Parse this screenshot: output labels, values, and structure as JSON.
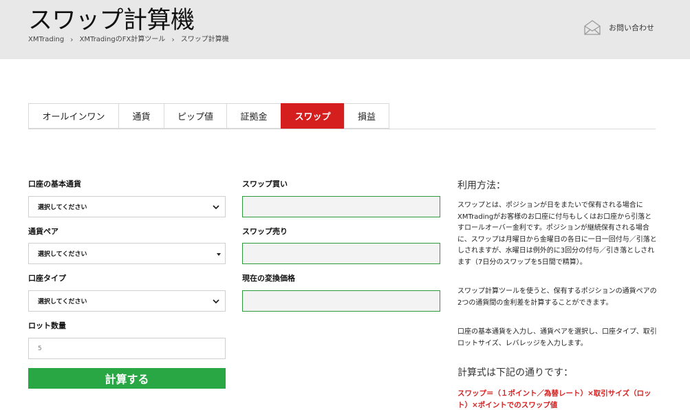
{
  "header": {
    "title": "スワップ計算機",
    "breadcrumb": [
      "XMTrading",
      "XMTradingのFX計算ツール",
      "スワップ計算機"
    ],
    "breadcrumb_separator": "›",
    "contact_label": "お問い合わせ",
    "contact_icon": "mail-icon"
  },
  "tabs": [
    {
      "label": "オールインワン",
      "active": false
    },
    {
      "label": "通貨",
      "active": false
    },
    {
      "label": "ピップ値",
      "active": false
    },
    {
      "label": "証拠金",
      "active": false
    },
    {
      "label": "スワップ",
      "active": true
    },
    {
      "label": "損益",
      "active": false
    }
  ],
  "form": {
    "base_currency": {
      "label": "口座の基本通貨",
      "value": "選択してください"
    },
    "currency_pair": {
      "label": "通貨ペア",
      "value": "選択してください"
    },
    "account_type": {
      "label": "口座タイプ",
      "value": "選択してください"
    },
    "lot_size": {
      "label": "ロット数量",
      "value": "5"
    },
    "calculate_label": "計算する"
  },
  "results": {
    "swap_buy": {
      "label": "スワップ買い",
      "value": ""
    },
    "swap_sell": {
      "label": "スワップ売り",
      "value": ""
    },
    "conversion_price": {
      "label": "現在の変換価格",
      "value": ""
    }
  },
  "usage": {
    "title": "利用方法：",
    "paragraphs": [
      "スワップとは、ポジションが日をまたいで保有される場合にXMTradingがお客様のお口座に付与もしくはお口座から引落とすロールオーバー金利です。ポジションが継続保有される場合に、スワップは月曜日から金曜日の各日に一日一回付与／引落としされますが、水曜日は例外的に3回分の付与／引き落としされます（7日分のスワップを5日間で精算）。",
      "スワップ計算ツールを使うと、保有するポジションの通貨ペアの2つの通貨間の金利差を計算することができます。",
      "口座の基本通貨を入力し、通貨ペアを選択し、口座タイプ、取引ロットサイズ、レバレッジを入力します。"
    ],
    "formula_title": "計算式は下記の通りです：",
    "formula": "スワップ＝（１ポイント／為替レート）×取引サイズ（ロット）×ポイントでのスワップ値"
  },
  "colors": {
    "accent_red": "#d51f1f",
    "button_green": "#2aa745",
    "result_border_green": "#2a9a3a",
    "header_bg": "#e8e8e8"
  }
}
